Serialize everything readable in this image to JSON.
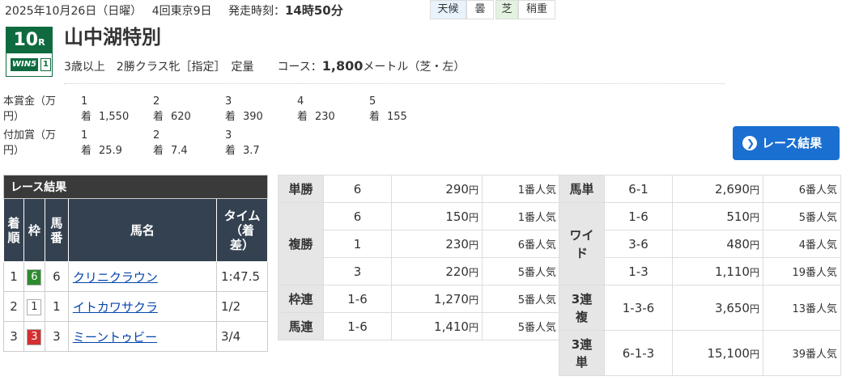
{
  "header": {
    "date": "2025年10月26日（日曜）",
    "meeting": "4回東京9日",
    "post_label": "発走時刻：",
    "post_time": "14時50分",
    "weather_label": "天候",
    "weather_value": "曇",
    "track_label": "芝",
    "track_value": "稍重"
  },
  "race": {
    "number": "10",
    "number_suffix": "R",
    "logo_text": "WIN5",
    "logo_num": "1",
    "name": "山中湖特別",
    "cond_class": "3歳以上　2勝クラス牝［指定］　定量",
    "course_label": "コース：",
    "distance": "1,800",
    "distance_unit": "メートル（芝・左）"
  },
  "prize": {
    "main_label": "本賞金（万円）",
    "main": [
      {
        "pos": "1着",
        "value": "1,550"
      },
      {
        "pos": "2着",
        "value": "620"
      },
      {
        "pos": "3着",
        "value": "390"
      },
      {
        "pos": "4着",
        "value": "230"
      },
      {
        "pos": "5着",
        "value": "155"
      }
    ],
    "add_label": "付加賞（万円）",
    "add": [
      {
        "pos": "1着",
        "value": "25.9"
      },
      {
        "pos": "2着",
        "value": "7.4"
      },
      {
        "pos": "3着",
        "value": "3.7"
      }
    ]
  },
  "result_button": "レース結果",
  "results": {
    "caption": "レース結果",
    "headers": {
      "rank": "着順",
      "waku": "枠",
      "num": "馬番",
      "name": "馬名",
      "time": "タイム（着差）"
    },
    "rows": [
      {
        "rank": "1",
        "waku": "6",
        "waku_color": "#2e8b2e",
        "waku_text": "#ffffff",
        "num": "6",
        "name": "クリニクラウン",
        "time": "1:47.5"
      },
      {
        "rank": "2",
        "waku": "1",
        "waku_color": "#ffffff",
        "waku_text": "#333333",
        "num": "1",
        "name": "イトカワサクラ",
        "time": "1/2"
      },
      {
        "rank": "3",
        "waku": "3",
        "waku_color": "#d32f2f",
        "waku_text": "#ffffff",
        "num": "3",
        "name": "ミーントゥビー",
        "time": "3/4"
      }
    ]
  },
  "payouts_left": {
    "tansho": {
      "label": "単勝",
      "rows": [
        {
          "num": "6",
          "yen": "290",
          "pop": "1番人気"
        }
      ]
    },
    "fukusho": {
      "label": "複勝",
      "rows": [
        {
          "num": "6",
          "yen": "150",
          "pop": "1番人気"
        },
        {
          "num": "1",
          "yen": "230",
          "pop": "6番人気"
        },
        {
          "num": "3",
          "yen": "220",
          "pop": "5番人気"
        }
      ]
    },
    "wakuren": {
      "label": "枠連",
      "rows": [
        {
          "num": "1-6",
          "yen": "1,270",
          "pop": "5番人気"
        }
      ]
    },
    "umaren": {
      "label": "馬連",
      "rows": [
        {
          "num": "1-6",
          "yen": "1,410",
          "pop": "5番人気"
        }
      ]
    }
  },
  "payouts_right": {
    "umatan": {
      "label": "馬単",
      "rows": [
        {
          "num": "6-1",
          "yen": "2,690",
          "pop": "6番人気"
        }
      ]
    },
    "wide": {
      "label": "ワイド",
      "rows": [
        {
          "num": "1-6",
          "yen": "510",
          "pop": "5番人気"
        },
        {
          "num": "3-6",
          "yen": "480",
          "pop": "4番人気"
        },
        {
          "num": "1-3",
          "yen": "1,110",
          "pop": "19番人気"
        }
      ]
    },
    "sanrenpuku": {
      "label": "3連複",
      "rows": [
        {
          "num": "1-3-6",
          "yen": "3,650",
          "pop": "13番人気"
        }
      ]
    },
    "sanrentan": {
      "label": "3連単",
      "rows": [
        {
          "num": "6-1-3",
          "yen": "15,100",
          "pop": "39番人気"
        }
      ]
    }
  },
  "yen_unit": "円"
}
